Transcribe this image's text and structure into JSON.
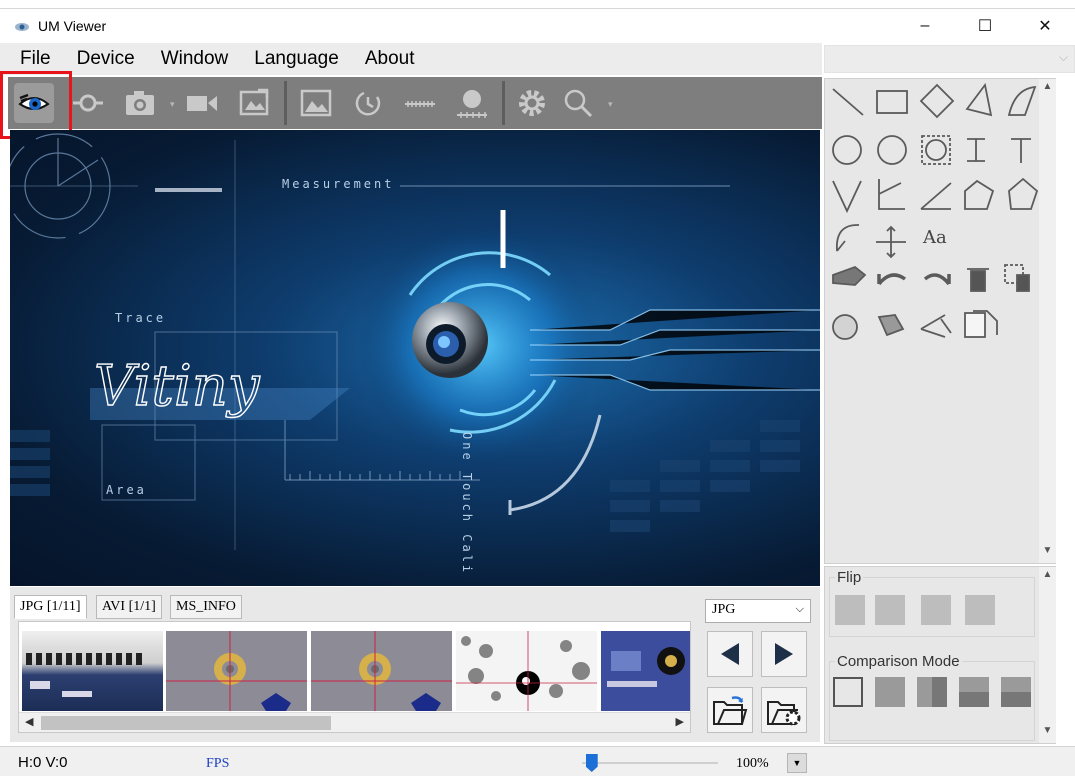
{
  "window": {
    "title": "UM Viewer",
    "minimize": "–",
    "maximize": "☐",
    "close": "✕"
  },
  "menu": [
    "File",
    "Device",
    "Window",
    "Language",
    "About"
  ],
  "canvas": {
    "labels": {
      "measurement": "Measurement",
      "trace": "Trace",
      "area": "Area",
      "one_touch": "One Touch Cali",
      "brand": "Vitiny"
    }
  },
  "panels": {
    "flip_label": "Flip",
    "comparison_label": "Comparison Mode"
  },
  "tool_panel": {
    "text_tool": "Aa"
  },
  "tabs": [
    "JPG [1/11]",
    "AVI [1/1]",
    "MS_INFO"
  ],
  "format_select": {
    "value": "JPG",
    "chevron": "⌵"
  },
  "status": {
    "hv": "H:0 V:0",
    "fps": "FPS",
    "zoom": "100%",
    "zoom_level": 0.03
  },
  "colors": {
    "toolbar": "#7e7e7e",
    "highlight": "#e8141c",
    "canvas_glow": "#1d6fb0",
    "fps_text": "#1d3fc4"
  }
}
